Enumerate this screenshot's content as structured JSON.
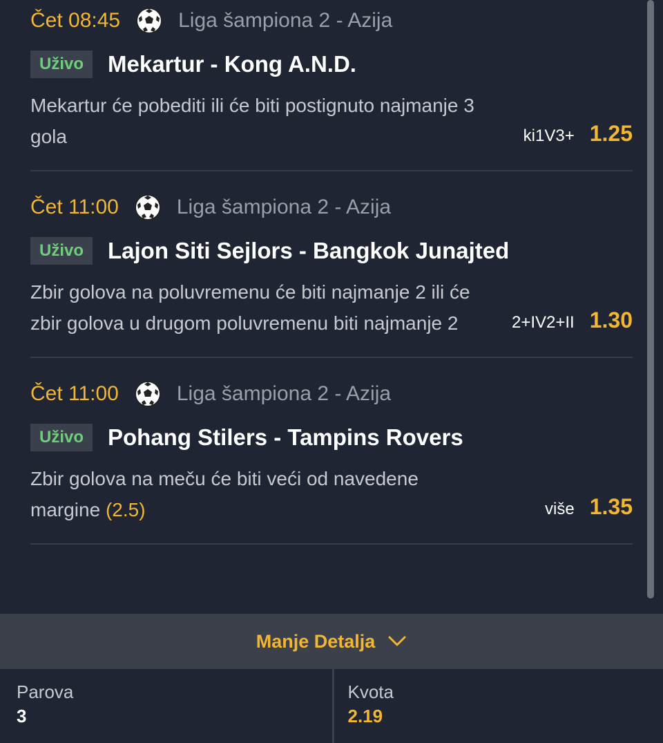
{
  "bets": [
    {
      "time": "Čet 08:45",
      "league": "Liga šampiona 2 - Azija",
      "live_label": "Uživo",
      "teams": "Mekartur - Kong A.N.D.",
      "description": "Mekartur će pobediti ili će biti postignuto najmanje 3 gola",
      "margin": "",
      "pick_code": "ki1V3+",
      "odd": "1.25"
    },
    {
      "time": "Čet 11:00",
      "league": "Liga šampiona 2 - Azija",
      "live_label": "Uživo",
      "teams": "Lajon Siti Sejlors - Bangkok Junajted",
      "description": "Zbir golova na poluvremenu će biti najmanje 2 ili će zbir golova u drugom poluvremenu biti najmanje 2",
      "margin": "",
      "pick_code": "2+IV2+II",
      "odd": "1.30"
    },
    {
      "time": "Čet 11:00",
      "league": "Liga šampiona 2 - Azija",
      "live_label": "Uživo",
      "teams": "Pohang Stilers - Tampins Rovers",
      "description": "Zbir golova na meču će biti veći od navedene margine",
      "margin": "(2.5)",
      "pick_code": "više",
      "odd": "1.35"
    }
  ],
  "details_toggle": {
    "label": "Manje Detalja",
    "icon": "chevron-down-icon"
  },
  "summary": {
    "pairs_label": "Parova",
    "pairs_value": "3",
    "odds_label": "Kvota",
    "odds_value": "2.19"
  },
  "colors": {
    "background": "#1f2533",
    "accent": "#f2b632",
    "live": "#6fce7c",
    "panel": "#3b404b"
  },
  "sport_icon": "soccer-ball-icon"
}
